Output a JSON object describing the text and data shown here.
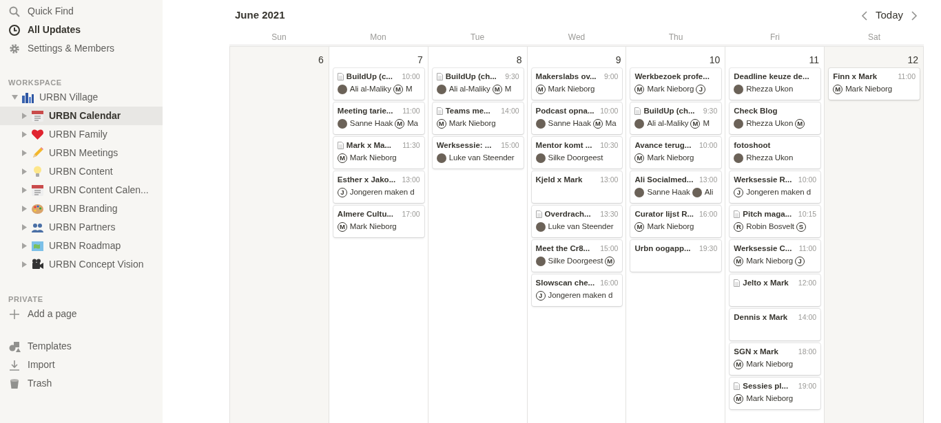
{
  "sidebar": {
    "top_items": [
      {
        "label": "Quick Find",
        "selected": false
      },
      {
        "label": "All Updates",
        "selected": true
      },
      {
        "label": "Settings & Members",
        "selected": false
      }
    ],
    "workspace": {
      "heading": "WORKSPACE",
      "pages": [
        {
          "label": "URBN Village",
          "expanded": true,
          "selected": false,
          "children": [
            {
              "label": "URBN Calendar",
              "expanded": false,
              "selected": true
            },
            {
              "label": "URBN Family",
              "expanded": false,
              "selected": false
            },
            {
              "label": "URBN Meetings",
              "expanded": false,
              "selected": false
            },
            {
              "label": "URBN Content",
              "expanded": false,
              "selected": false
            },
            {
              "label": "URBN Content Calen...",
              "expanded": false,
              "selected": false
            },
            {
              "label": "URBN Branding",
              "expanded": false,
              "selected": false
            },
            {
              "label": "URBN Partners",
              "expanded": false,
              "selected": false
            },
            {
              "label": "URBN Roadmap",
              "expanded": false,
              "selected": false
            },
            {
              "label": "URBN Concept Vision",
              "expanded": false,
              "selected": false
            }
          ]
        }
      ]
    },
    "private": {
      "heading": "PRIVATE",
      "add_label": "Add a page"
    },
    "bottom_items": [
      {
        "label": "Templates"
      },
      {
        "label": "Import"
      },
      {
        "label": "Trash"
      }
    ]
  },
  "calendar": {
    "month": "June 2021",
    "today_label": "Today",
    "weekdays": [
      "Sun",
      "Mon",
      "Tue",
      "Wed",
      "Thu",
      "Fri",
      "Sat"
    ],
    "days": [
      {
        "number": "6",
        "weekend": true
      },
      {
        "number": "7",
        "weekend": false,
        "events": [
          {
            "title": "BuildUp (c...",
            "time": "10:00",
            "page": true,
            "people": [
              {
                "kind": "photo",
                "name": "Ali al-Maliky"
              },
              {
                "kind": "initial",
                "initial": "M",
                "name": "M"
              }
            ]
          },
          {
            "title": "Meeting tarie...",
            "time": "11:00",
            "page": false,
            "people": [
              {
                "kind": "photo",
                "name": "Sanne Haak"
              },
              {
                "kind": "initial",
                "initial": "M",
                "name": "Ma"
              }
            ]
          },
          {
            "title": "Mark x Ma...",
            "time": "11:30",
            "page": true,
            "people": [
              {
                "kind": "initial",
                "initial": "M",
                "name": "Mark Nieborg"
              }
            ]
          },
          {
            "title": "Esther x Jako...",
            "time": "13:00",
            "page": false,
            "people": [
              {
                "kind": "initial",
                "initial": "J",
                "name": "Jongeren maken d"
              }
            ]
          },
          {
            "title": "Almere Cultu...",
            "time": "17:00",
            "page": false,
            "people": [
              {
                "kind": "initial",
                "initial": "M",
                "name": "Mark Nieborg"
              }
            ]
          }
        ]
      },
      {
        "number": "8",
        "weekend": false,
        "events": [
          {
            "title": "BuildUp (ch...",
            "time": "9:30",
            "page": true,
            "people": [
              {
                "kind": "photo",
                "name": "Ali al-Maliky"
              },
              {
                "kind": "initial",
                "initial": "M",
                "name": "M"
              }
            ]
          },
          {
            "title": "Teams me...",
            "time": "14:00",
            "page": true,
            "people": [
              {
                "kind": "initial",
                "initial": "M",
                "name": "Mark Nieborg"
              }
            ]
          },
          {
            "title": "Werksessie: ...",
            "time": "15:00",
            "page": false,
            "people": [
              {
                "kind": "photo",
                "name": "Luke van Steender"
              }
            ]
          }
        ]
      },
      {
        "number": "9",
        "weekend": false,
        "events": [
          {
            "title": "Makerslabs ov...",
            "time": "9:00",
            "page": false,
            "people": [
              {
                "kind": "initial",
                "initial": "M",
                "name": "Mark Nieborg"
              }
            ]
          },
          {
            "title": "Podcast opna...",
            "time": "10:00",
            "page": false,
            "people": [
              {
                "kind": "photo",
                "name": "Sanne Haak"
              },
              {
                "kind": "initial",
                "initial": "M",
                "name": "Ma"
              }
            ]
          },
          {
            "title": "Mentor komt ...",
            "time": "10:30",
            "page": false,
            "people": [
              {
                "kind": "photo",
                "name": "Silke Doorgeest"
              }
            ]
          },
          {
            "title": "Kjeld x Mark",
            "time": "13:00",
            "page": false
          },
          {
            "title": "Overdrach...",
            "time": "13:30",
            "page": true,
            "people": [
              {
                "kind": "photo",
                "name": "Luke van Steender"
              }
            ]
          },
          {
            "title": "Meet the Cr8...",
            "time": "15:00",
            "page": false,
            "people": [
              {
                "kind": "photo",
                "name": "Silke Doorgeest"
              },
              {
                "kind": "initial",
                "initial": "M"
              }
            ]
          },
          {
            "title": "Slowscan che...",
            "time": "16:00",
            "page": false,
            "people": [
              {
                "kind": "initial",
                "initial": "J",
                "name": "Jongeren maken d"
              }
            ]
          }
        ]
      },
      {
        "number": "10",
        "weekend": false,
        "events": [
          {
            "title": "Werkbezoek profe...",
            "page": false,
            "people": [
              {
                "kind": "initial",
                "initial": "M",
                "name": "Mark Nieborg"
              },
              {
                "kind": "initial",
                "initial": "J"
              }
            ]
          },
          {
            "title": "BuildUp (ch...",
            "time": "9:30",
            "page": true,
            "people": [
              {
                "kind": "photo",
                "name": "Ali al-Maliky"
              },
              {
                "kind": "initial",
                "initial": "M",
                "name": "M"
              }
            ]
          },
          {
            "title": "Avance terug...",
            "time": "10:00",
            "page": false,
            "people": [
              {
                "kind": "initial",
                "initial": "M",
                "name": "Mark Nieborg"
              }
            ]
          },
          {
            "title": "Ali Socialmed...",
            "time": "13:00",
            "page": false,
            "people": [
              {
                "kind": "photo",
                "name": "Sanne Haak"
              },
              {
                "kind": "photo",
                "name": "Ali"
              }
            ]
          },
          {
            "title": "Curator lijst R...",
            "time": "16:00",
            "page": false,
            "people": [
              {
                "kind": "initial",
                "initial": "M",
                "name": "Mark Nieborg"
              }
            ]
          },
          {
            "title": "Urbn oogapp...",
            "time": "19:30",
            "page": false
          }
        ]
      },
      {
        "number": "11",
        "weekend": false,
        "events": [
          {
            "title": "Deadline keuze de...",
            "page": false,
            "people": [
              {
                "kind": "photo",
                "name": "Rhezza Ukon"
              }
            ]
          },
          {
            "title": "Check Blog",
            "page": false,
            "people": [
              {
                "kind": "photo",
                "name": "Rhezza Ukon"
              },
              {
                "kind": "initial",
                "initial": "M"
              }
            ]
          },
          {
            "title": "fotoshoot",
            "page": false,
            "people": [
              {
                "kind": "photo",
                "name": "Rhezza Ukon"
              }
            ]
          },
          {
            "title": "Werksessie R...",
            "time": "10:00",
            "page": false,
            "people": [
              {
                "kind": "initial",
                "initial": "J",
                "name": "Jongeren maken d"
              }
            ]
          },
          {
            "title": "Pitch maga...",
            "time": "10:15",
            "page": true,
            "people": [
              {
                "kind": "initial",
                "initial": "R",
                "name": "Robin Bosvelt"
              },
              {
                "kind": "initial",
                "initial": "S"
              }
            ]
          },
          {
            "title": "Werksessie C...",
            "time": "11:00",
            "page": false,
            "people": [
              {
                "kind": "initial",
                "initial": "M",
                "name": "Mark Nieborg"
              },
              {
                "kind": "initial",
                "initial": "J"
              }
            ]
          },
          {
            "title": "Jelto x Mark",
            "time": "12:00",
            "page": true
          },
          {
            "title": "Dennis x Mark",
            "time": "14:00",
            "page": false
          },
          {
            "title": "SGN x Mark",
            "time": "18:00",
            "page": false,
            "people": [
              {
                "kind": "initial",
                "initial": "M",
                "name": "Mark Nieborg"
              }
            ]
          },
          {
            "title": "Sessies pl...",
            "time": "19:00",
            "page": true,
            "people": [
              {
                "kind": "initial",
                "initial": "M",
                "name": "Mark Nieborg"
              }
            ]
          }
        ]
      },
      {
        "number": "12",
        "weekend": true,
        "events": [
          {
            "title": "Finn x Mark",
            "time": "11:00",
            "page": false,
            "people": [
              {
                "kind": "initial",
                "initial": "M",
                "name": "Mark Nieborg"
              }
            ]
          }
        ]
      }
    ]
  }
}
